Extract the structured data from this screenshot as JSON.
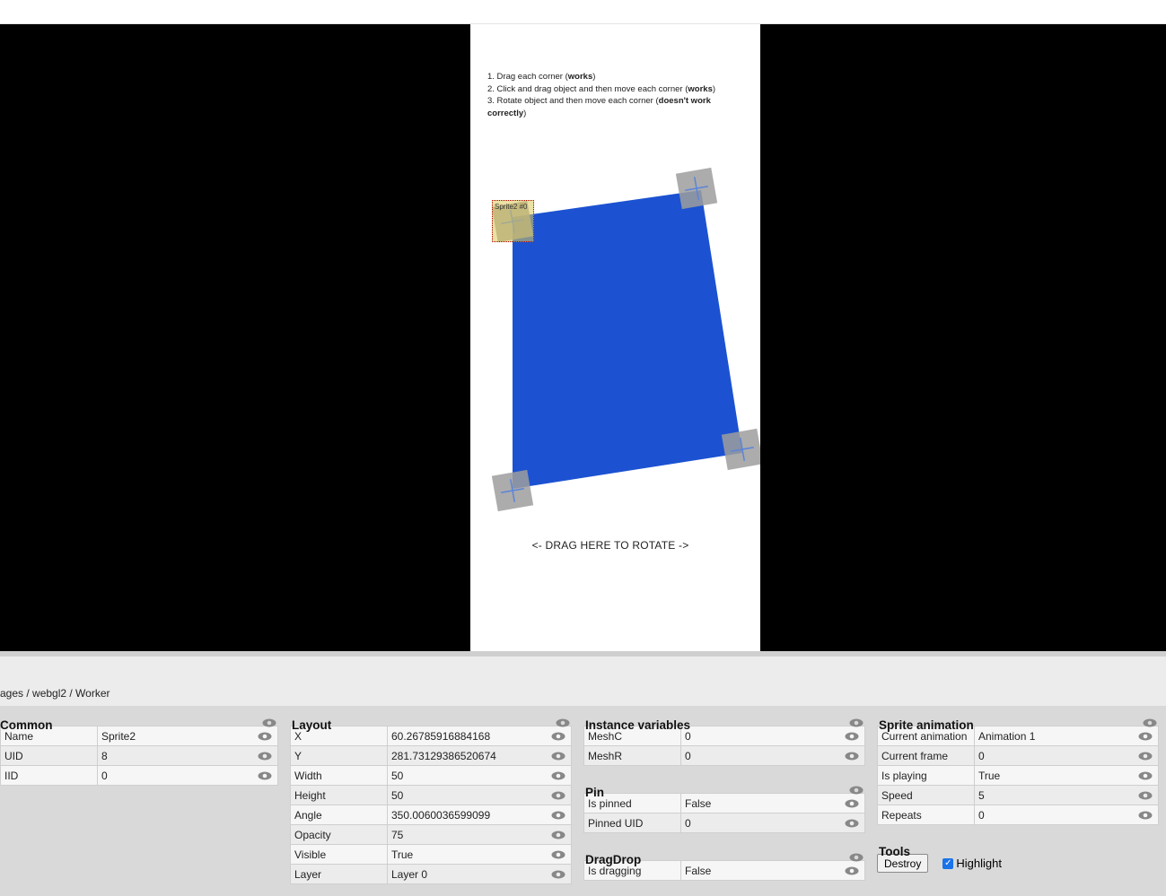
{
  "game": {
    "instructions": [
      {
        "pre": "1. Drag each corner (",
        "bold": "works",
        "post": ")"
      },
      {
        "pre": "2. Click and drag object and then move each corner (",
        "bold": "works",
        "post": ")"
      },
      {
        "pre": "3. Rotate object and then move each corner (",
        "bold": "doesn't work correctly",
        "post": ")"
      }
    ],
    "rotate_label": "<- DRAG HERE TO ROTATE ->",
    "sprite_tag": "Sprite2 #0",
    "quad_color": "#1c52d1"
  },
  "debugger": {
    "breadcrumb": "ages / webgl2 / Worker",
    "common": {
      "title": "Common",
      "rows": [
        {
          "key": "Name",
          "value": "Sprite2"
        },
        {
          "key": "UID",
          "value": "8"
        },
        {
          "key": "IID",
          "value": "0"
        }
      ]
    },
    "layout": {
      "title": "Layout",
      "rows": [
        {
          "key": "X",
          "value": "60.26785916884168"
        },
        {
          "key": "Y",
          "value": "281.73129386520674"
        },
        {
          "key": "Width",
          "value": "50"
        },
        {
          "key": "Height",
          "value": "50"
        },
        {
          "key": "Angle",
          "value": "350.0060036599099"
        },
        {
          "key": "Opacity",
          "value": "75"
        },
        {
          "key": "Visible",
          "value": "True"
        },
        {
          "key": "Layer",
          "value": "Layer 0"
        }
      ]
    },
    "instance_variables": {
      "title": "Instance variables",
      "rows": [
        {
          "key": "MeshC",
          "value": "0"
        },
        {
          "key": "MeshR",
          "value": "0"
        }
      ]
    },
    "pin": {
      "title": "Pin",
      "rows": [
        {
          "key": "Is pinned",
          "value": "False"
        },
        {
          "key": "Pinned UID",
          "value": "0"
        }
      ]
    },
    "dragdrop": {
      "title": "DragDrop",
      "rows": [
        {
          "key": "Is dragging",
          "value": "False"
        }
      ]
    },
    "sprite_animation": {
      "title": "Sprite animation",
      "rows": [
        {
          "key": "Current animation",
          "value": "Animation 1"
        },
        {
          "key": "Current frame",
          "value": "0"
        },
        {
          "key": "Is playing",
          "value": "True"
        },
        {
          "key": "Speed",
          "value": "5"
        },
        {
          "key": "Repeats",
          "value": "0"
        }
      ]
    },
    "tools": {
      "title": "Tools",
      "destroy_label": "Destroy",
      "highlight_label": "Highlight",
      "highlight_checked": true
    }
  }
}
